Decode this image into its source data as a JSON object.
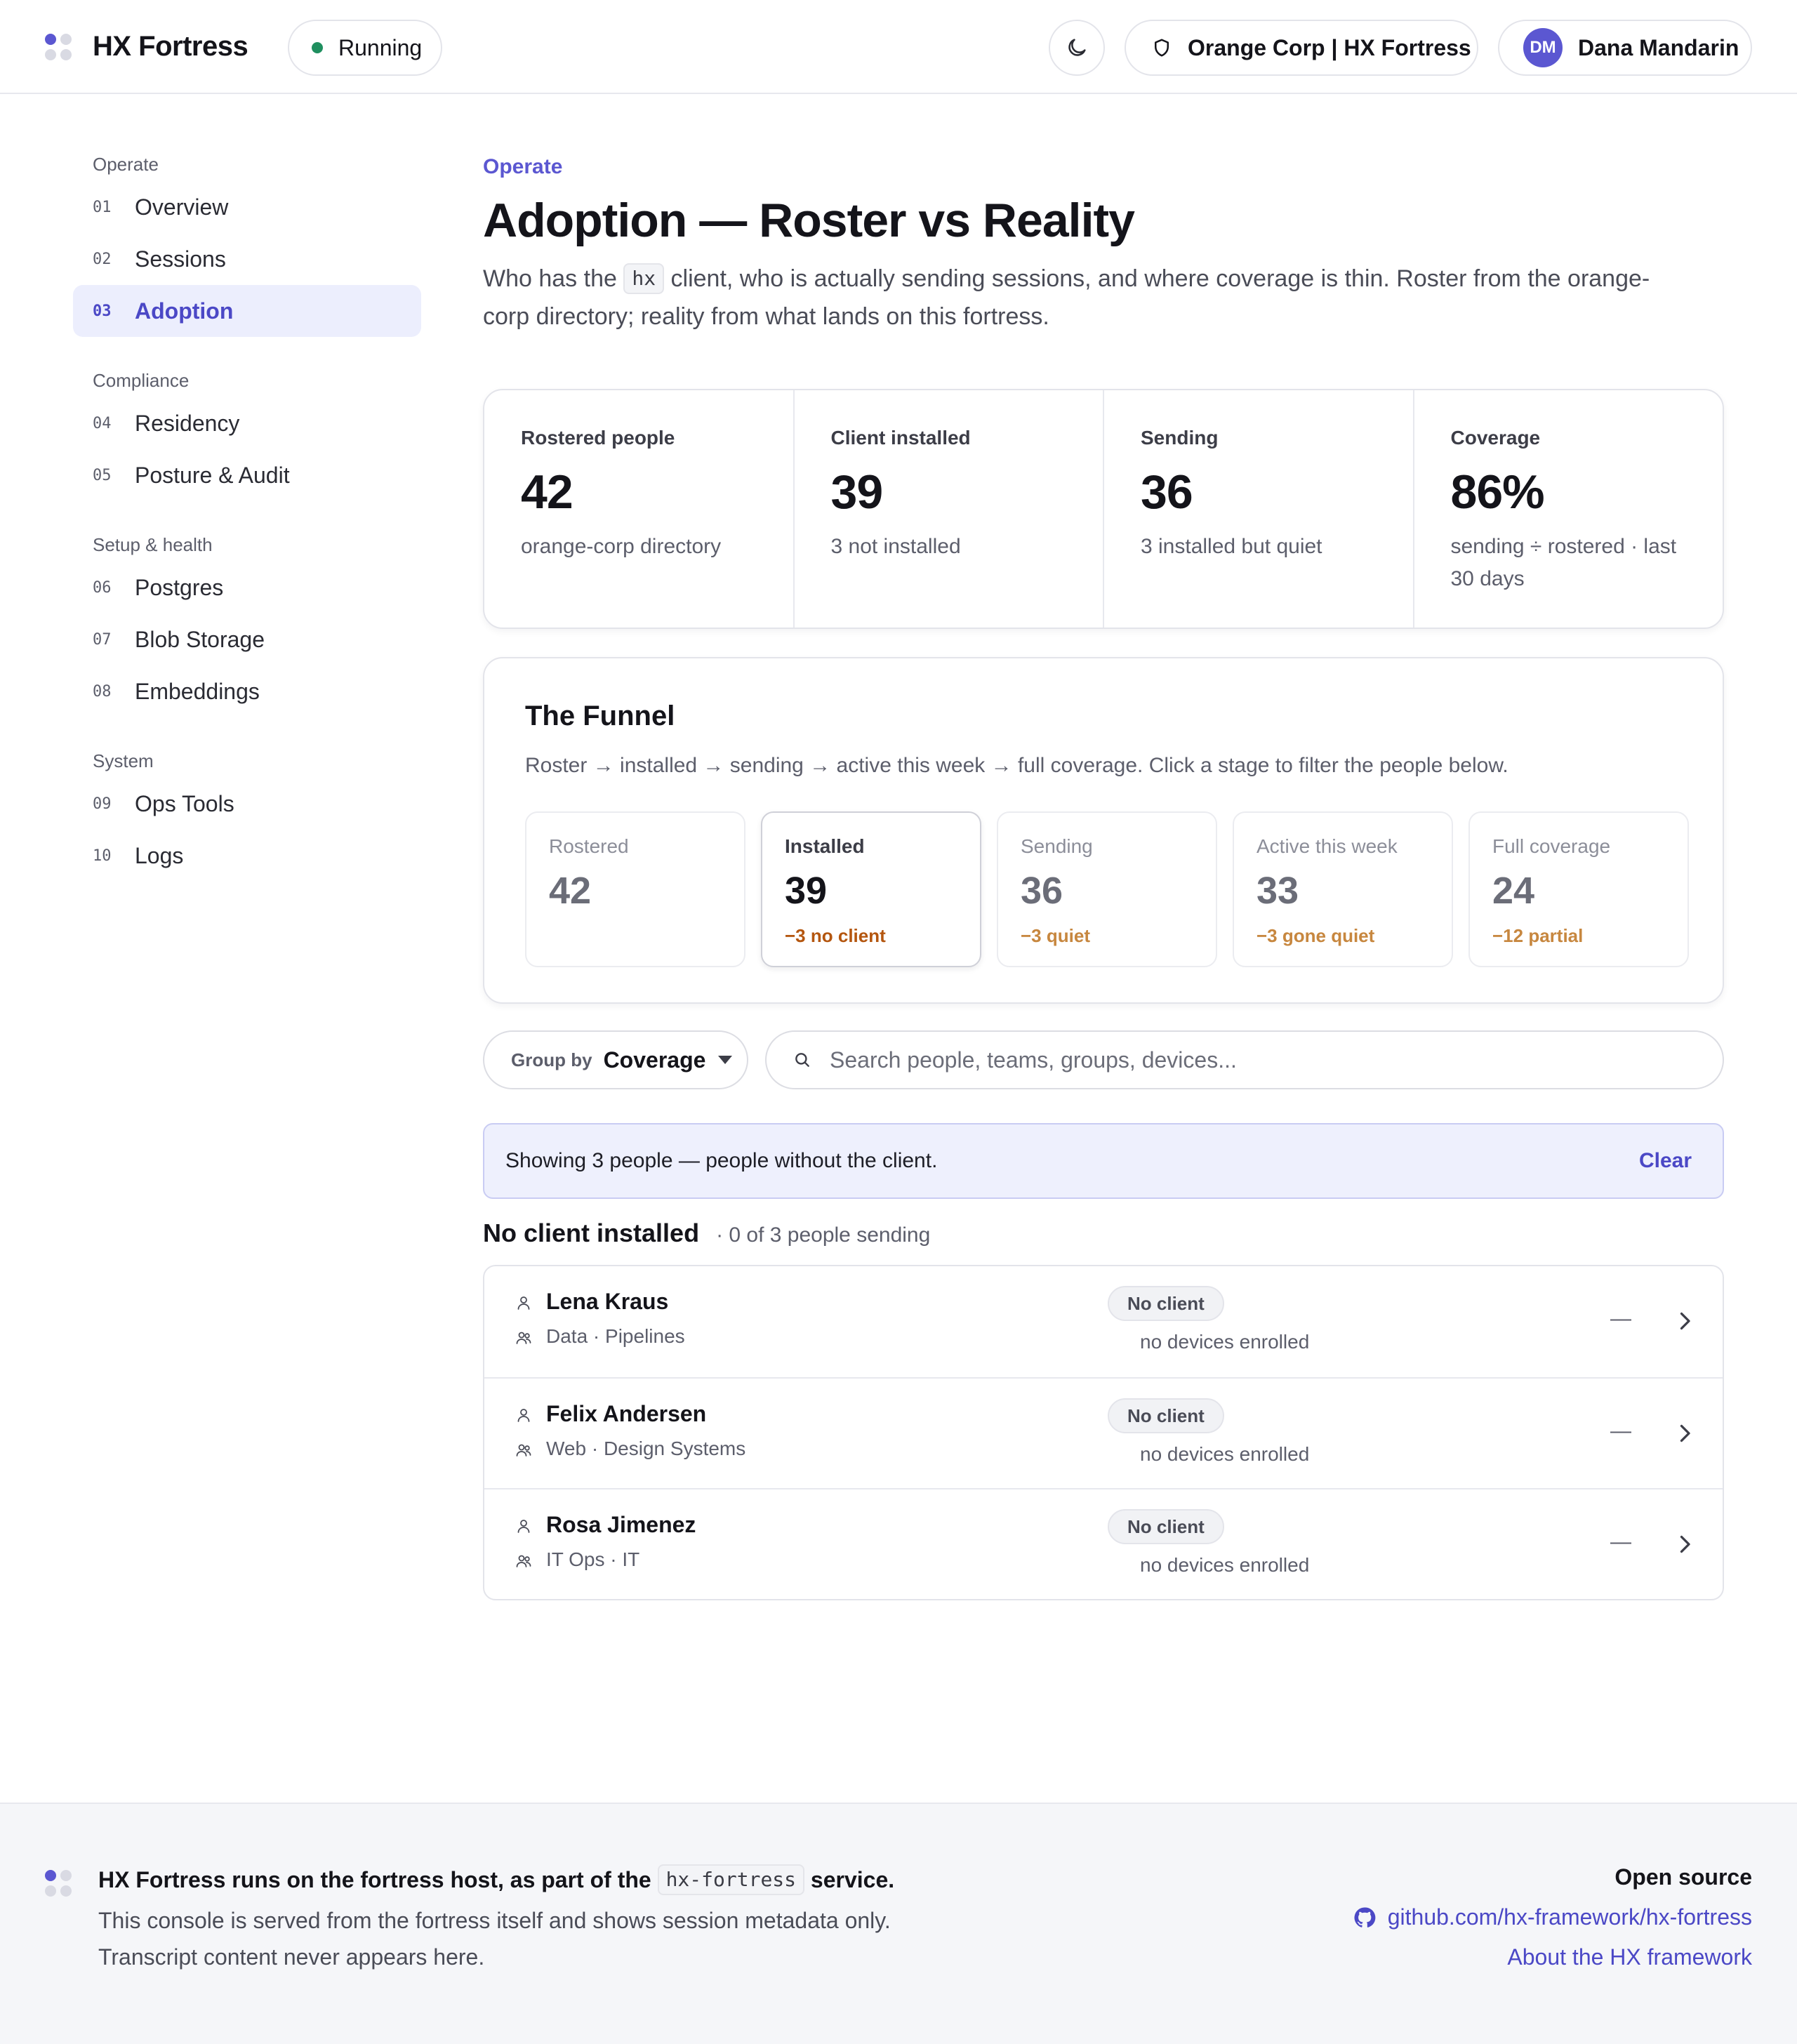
{
  "app": {
    "brand": "HX Fortress",
    "status": "Running"
  },
  "header": {
    "org": "Orange Corp | HX Fortress",
    "user_initials": "DM",
    "user_name": "Dana Mandarin"
  },
  "sidebar": {
    "groups": [
      {
        "title": "Operate",
        "items": [
          {
            "num": "01",
            "label": "Overview"
          },
          {
            "num": "02",
            "label": "Sessions"
          },
          {
            "num": "03",
            "label": "Adoption"
          }
        ]
      },
      {
        "title": "Compliance",
        "items": [
          {
            "num": "04",
            "label": "Residency"
          },
          {
            "num": "05",
            "label": "Posture & Audit"
          }
        ]
      },
      {
        "title": "Setup & health",
        "items": [
          {
            "num": "06",
            "label": "Postgres"
          },
          {
            "num": "07",
            "label": "Blob Storage"
          },
          {
            "num": "08",
            "label": "Embeddings"
          }
        ]
      },
      {
        "title": "System",
        "items": [
          {
            "num": "09",
            "label": "Ops Tools"
          },
          {
            "num": "10",
            "label": "Logs"
          }
        ]
      }
    ]
  },
  "page": {
    "eyebrow": "Operate",
    "title": "Adoption — Roster vs Reality",
    "desc_pre": "Who has the",
    "desc_code": "hx",
    "desc_post": "client, who is actually sending sessions, and where coverage is thin. Roster from the orange-corp directory; reality from what lands on this fortress."
  },
  "stats": [
    {
      "label": "Rostered people",
      "value": "42",
      "sub": "orange-corp directory"
    },
    {
      "label": "Client installed",
      "value": "39",
      "sub": "3 not installed"
    },
    {
      "label": "Sending",
      "value": "36",
      "sub": "3 installed but quiet"
    },
    {
      "label": "Coverage",
      "value": "86%",
      "sub": "sending ÷ rostered · last 30 days"
    }
  ],
  "funnel": {
    "title": "The Funnel",
    "desc": "Roster → installed → sending → active this week → full coverage. Click a stage to filter the people below.",
    "stages": [
      {
        "label": "Rostered",
        "value": "42",
        "delta": ""
      },
      {
        "label": "Installed",
        "value": "39",
        "delta": "−3 no client"
      },
      {
        "label": "Sending",
        "value": "36",
        "delta": "−3 quiet"
      },
      {
        "label": "Active this week",
        "value": "33",
        "delta": "−3 gone quiet"
      },
      {
        "label": "Full coverage",
        "value": "24",
        "delta": "−12 partial"
      }
    ]
  },
  "controls": {
    "group_by_label": "Group by",
    "group_by_value": "Coverage",
    "search_placeholder": "Search people, teams, groups, devices..."
  },
  "filter": {
    "text": "Showing 3 people — people without the client.",
    "clear": "Clear"
  },
  "section": {
    "title": "No client installed",
    "meta": "· 0 of 3 people sending"
  },
  "people": [
    {
      "name": "Lena Kraus",
      "team": "Data · Pipelines",
      "badge": "No client",
      "devices": "no devices enrolled",
      "activity": "—"
    },
    {
      "name": "Felix Andersen",
      "team": "Web · Design Systems",
      "badge": "No client",
      "devices": "no devices enrolled",
      "activity": "—"
    },
    {
      "name": "Rosa Jimenez",
      "team": "IT Ops · IT",
      "badge": "No client",
      "devices": "no devices enrolled",
      "activity": "—"
    }
  ],
  "footer": {
    "line1_pre": "HX Fortress runs on the fortress host, as part of the",
    "line1_code": "hx-fortress",
    "line1_post": "service.",
    "line2": "This console is served from the fortress itself and shows session metadata only.",
    "line3": "Transcript content never appears here.",
    "open_source_title": "Open source",
    "repo_link": "github.com/hx-framework/hx-fortress",
    "about_link": "About the HX framework"
  }
}
